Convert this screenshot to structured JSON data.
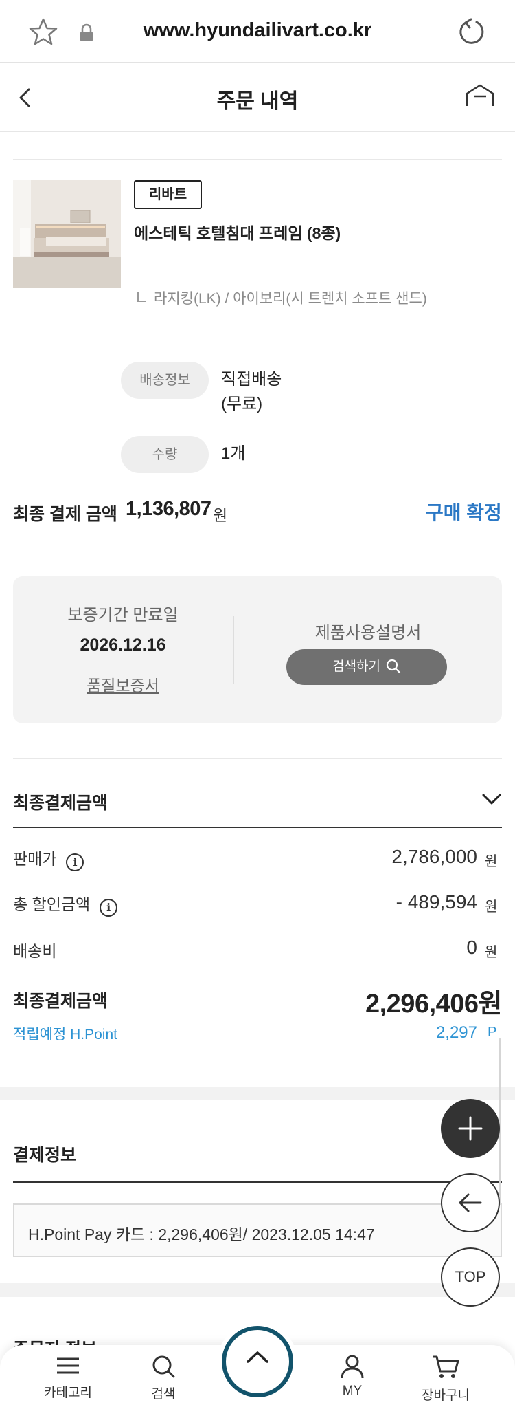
{
  "browser": {
    "url": "www.hyundailivart.co.kr"
  },
  "header": {
    "title": "주문 내역"
  },
  "product": {
    "badge": "리바트",
    "name": "에스테틱 호텔침대 프레임 (8종)",
    "option": "라지킹(LK) / 아이보리(시 트렌치 소프트 샌드)"
  },
  "delivery": {
    "label": "배송정보",
    "value_line1": "직접배송",
    "value_line2": "(무료)"
  },
  "quantity": {
    "label": "수량",
    "value": "1개"
  },
  "final_payment": {
    "label": "최종 결제 금액",
    "amount": "1,136,807",
    "unit": "원",
    "confirm_label": "구매 확정"
  },
  "warranty": {
    "expiry_label": "보증기간 만료일",
    "expiry_date": "2026.12.16",
    "certificate_link": "품질보증서",
    "manual_label": "제품사용설명서",
    "search_button": "검색하기"
  },
  "summary": {
    "title": "최종결제금액",
    "rows": [
      {
        "label": "판매가",
        "value": "2,786,000",
        "unit": "원"
      },
      {
        "label": "총 할인금액",
        "value": "- 489,594",
        "unit": "원"
      },
      {
        "label": "배송비",
        "value": "0",
        "unit": "원"
      }
    ],
    "total_label": "최종결제금액",
    "total_value": "2,296,406원",
    "point_label": "적립예정 H.Point",
    "point_value": "2,297",
    "point_unit": "P"
  },
  "payment": {
    "title": "결제정보",
    "detail": "H.Point Pay 카드 : 2,296,406원/ 2023.12.05 14:47"
  },
  "orderer": {
    "title": "주문자 정보"
  },
  "floating": {
    "top_label": "TOP"
  },
  "bottom_nav": {
    "category": "카테고리",
    "search": "검색",
    "my": "MY",
    "cart": "장바구니"
  },
  "colors": {
    "accent_blue": "#2b78c5",
    "point_blue": "#2d93d3",
    "nav_ring": "#12536b",
    "fab_dark": "#333333"
  }
}
